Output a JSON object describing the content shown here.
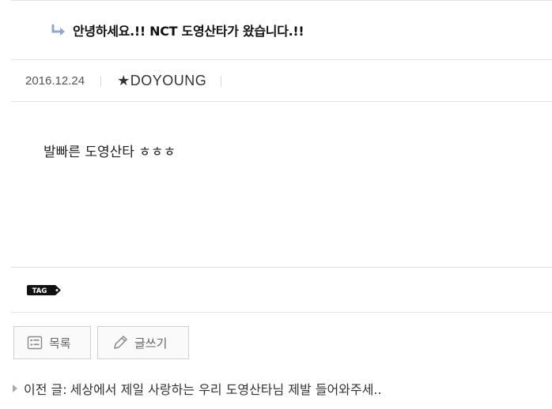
{
  "post": {
    "title": "안녕하세요.!! NCT 도영산타가 왔습니다.!!",
    "date": "2016.12.24",
    "author": "★DOYOUNG",
    "content": "발빠른 도영산타 ㅎㅎㅎ"
  },
  "tag": {
    "label": "TAG"
  },
  "buttons": {
    "list_label": "목록",
    "write_label": "글쓰기"
  },
  "navigation": {
    "prev_label": "이전 글:",
    "prev_title": "세상에서 제일 사랑하는 우리 도영산타님 제발 들어와주세.."
  },
  "icons": {
    "reply": "reply-arrow-icon",
    "tag": "tag-icon",
    "list": "list-icon",
    "write": "pencil-icon",
    "prev": "triangle-right-icon"
  },
  "colors": {
    "border": "#e2e2e2",
    "reply_arrow": "#8fa8c8",
    "tag_bg": "#111111"
  }
}
